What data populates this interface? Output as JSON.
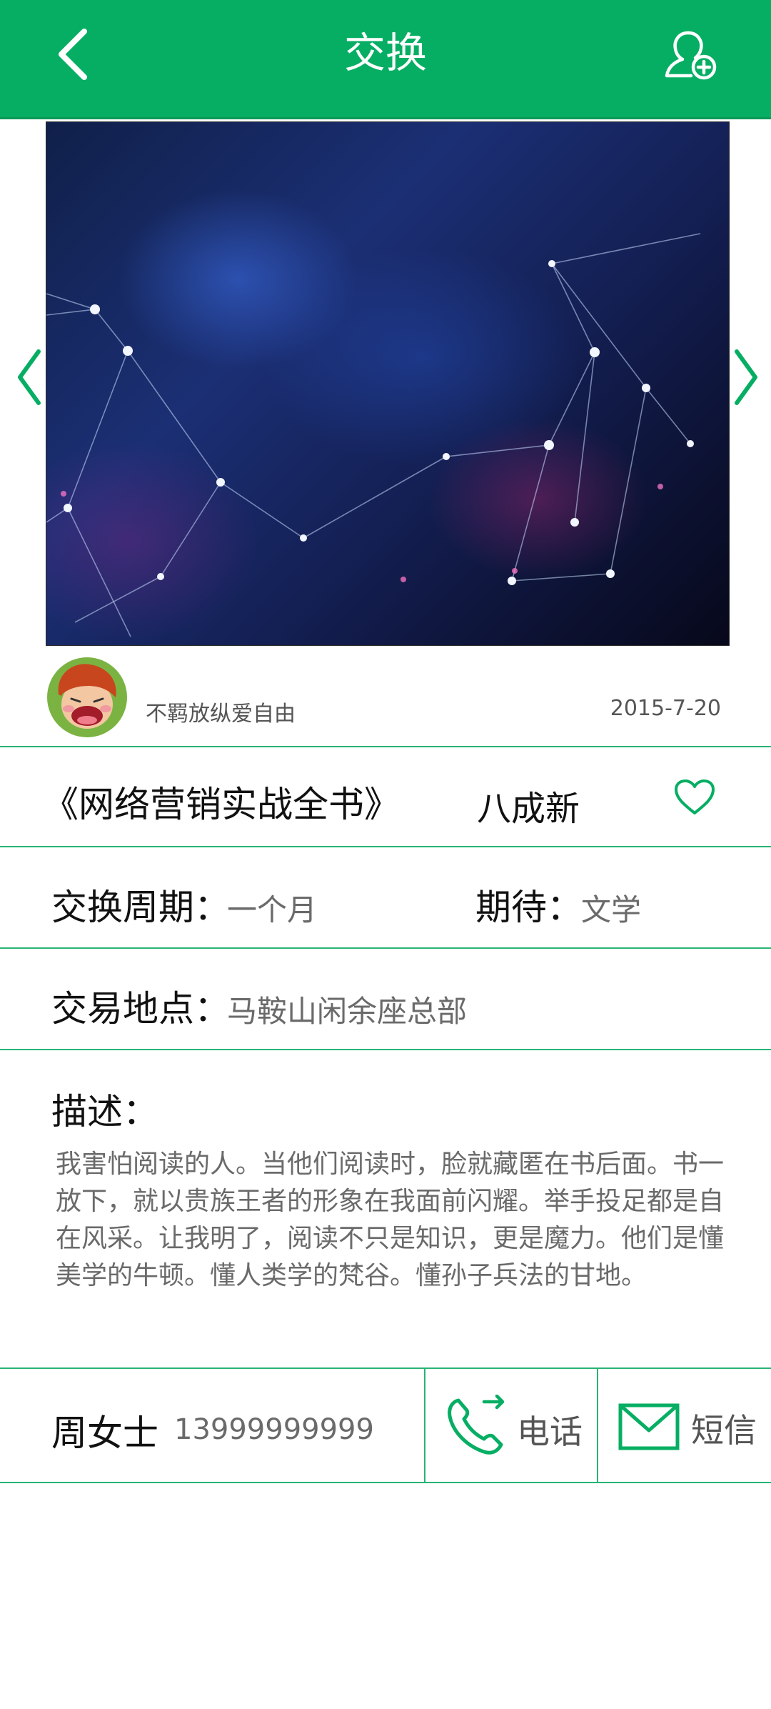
{
  "header": {
    "title": "交换",
    "back_icon": "chevron-left-icon",
    "action_icon": "add-user-icon",
    "background_color": "#06ae63"
  },
  "gallery": {
    "prev_icon": "chevron-left-icon",
    "next_icon": "chevron-right-icon",
    "image": "abstract network-of-lights photo"
  },
  "owner": {
    "username": "不羁放纵爱自由",
    "date": "2015-7-20"
  },
  "book": {
    "title": "《网络营销实战全书》",
    "condition": "八成新",
    "favorite_icon": "heart-outline-icon"
  },
  "details": {
    "period_label": "交换周期：",
    "period_value": "一个月",
    "expect_label": "期待：",
    "expect_value": "文学",
    "location_label": "交易地点：",
    "location_value": "马鞍山闲余座总部"
  },
  "description": {
    "label": "描述：",
    "text": "我害怕阅读的人。当他们阅读时，脸就藏匿在书后面。书一放下，就以贵族王者的形象在我面前闪耀。举手投足都是自在风采。让我明了，阅读不只是知识，更是魔力。他们是懂美学的牛顿。懂人类学的梵谷。懂孙子兵法的甘地。"
  },
  "contact": {
    "name": "周女士",
    "phone": "13999999999",
    "call_label": "电话",
    "sms_label": "短信",
    "accent_color": "#06ae63"
  }
}
